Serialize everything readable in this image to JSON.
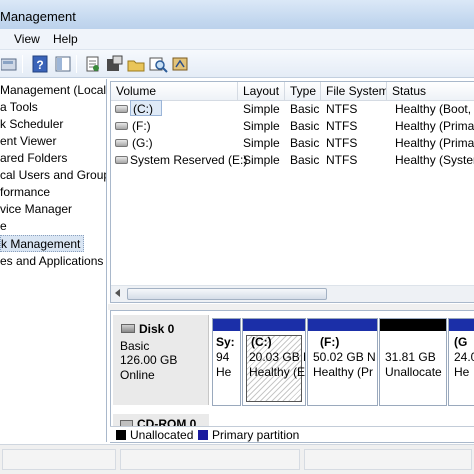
{
  "window": {
    "title": "Management"
  },
  "menu": {
    "items": [
      "View",
      "Help"
    ]
  },
  "toolbar": {
    "buttons": [
      "disk-icon",
      "help-icon",
      "panel-icon",
      "properties-icon",
      "settings-icon",
      "open-folder-icon",
      "search-icon",
      "wizard-icon"
    ]
  },
  "tree": {
    "items": [
      "Management (Local",
      "a Tools",
      "k Scheduler",
      "ent Viewer",
      "ared Folders",
      "cal Users and Groups",
      "formance",
      "vice Manager",
      "e",
      "k Management",
      "es and Applications"
    ],
    "selected_index": 9
  },
  "volumes": {
    "columns": [
      "Volume",
      "Layout",
      "Type",
      "File System",
      "Status"
    ],
    "rows": [
      {
        "volume": "(C:)",
        "layout": "Simple",
        "type": "Basic",
        "fs": "NTFS",
        "status": "Healthy (Boot, Pa"
      },
      {
        "volume": "(F:)",
        "layout": "Simple",
        "type": "Basic",
        "fs": "NTFS",
        "status": "Healthy (Primary"
      },
      {
        "volume": "(G:)",
        "layout": "Simple",
        "type": "Basic",
        "fs": "NTFS",
        "status": "Healthy (Primary"
      },
      {
        "volume": "System Reserved (E:)",
        "layout": "Simple",
        "type": "Basic",
        "fs": "NTFS",
        "status": "Healthy (System"
      }
    ]
  },
  "disk0": {
    "name": "Disk 0",
    "type": "Basic",
    "size": "126.00 GB",
    "state": "Online",
    "partitions": [
      {
        "name": "Sy:",
        "size": "94",
        "status": "He"
      },
      {
        "name": "(C:)",
        "size": "20.03 GB N",
        "status": "Healthy (E"
      },
      {
        "name": "(F:)",
        "size": "50.02 GB N",
        "status": "Healthy (Pr"
      },
      {
        "name": "",
        "size": "31.81 GB",
        "status": "Unallocate"
      },
      {
        "name": "(G",
        "size": "24.0",
        "status": "He"
      }
    ]
  },
  "cdrom": {
    "name": "CD-ROM 0"
  },
  "legend": {
    "items": [
      {
        "label": "Unallocated",
        "color": "#000000"
      },
      {
        "label": "Primary partition",
        "color": "#1a1a9e"
      }
    ]
  },
  "colors": {
    "primary_bar": "#1b2fa8",
    "unallocated_bar": "#000000"
  }
}
